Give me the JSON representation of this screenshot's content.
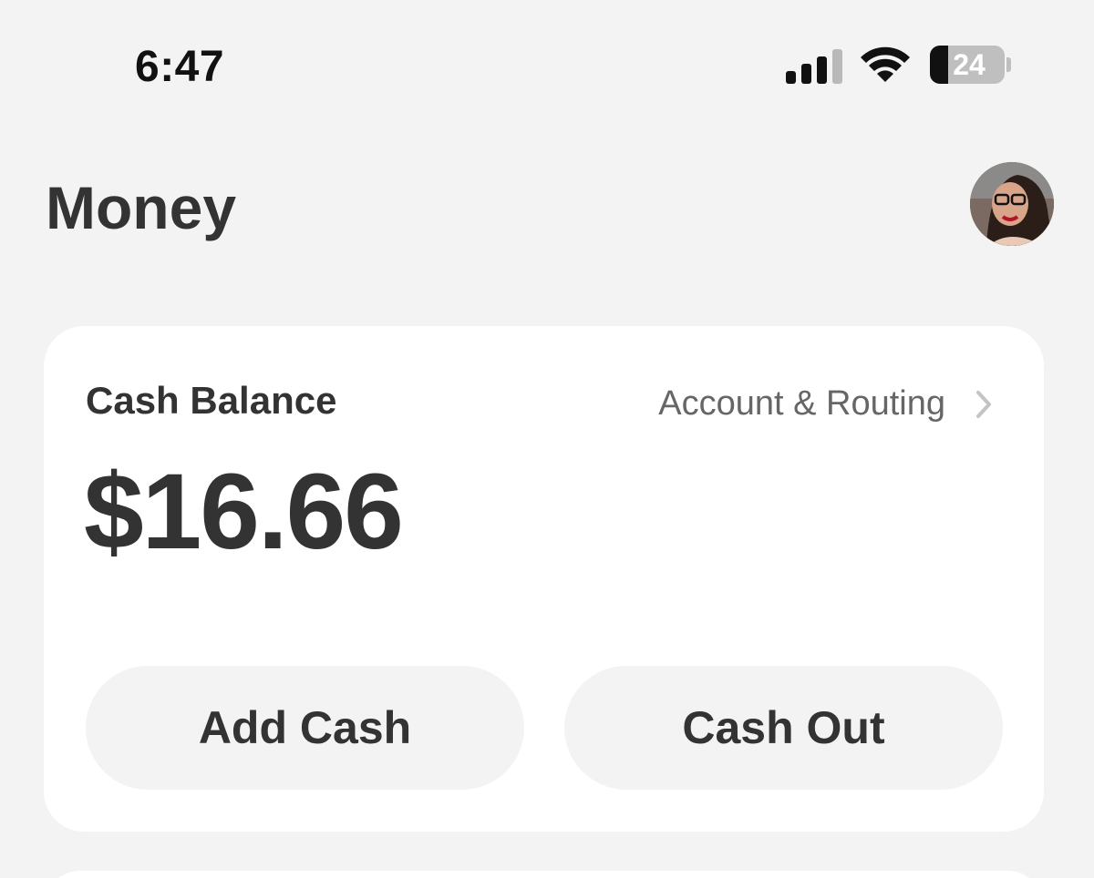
{
  "status_bar": {
    "time": "6:47",
    "battery_level": "24",
    "signal_bars_active": 3,
    "signal_bars_total": 4
  },
  "header": {
    "title": "Money",
    "avatar_icon": "user-avatar"
  },
  "balance_card": {
    "label": "Cash Balance",
    "account_link": "Account & Routing",
    "amount": "$16.66",
    "buttons": {
      "add_cash": "Add Cash",
      "cash_out": "Cash Out"
    }
  },
  "colors": {
    "background": "#f3f3f3",
    "card": "#ffffff",
    "text": "#333333",
    "muted_text": "#666666"
  }
}
